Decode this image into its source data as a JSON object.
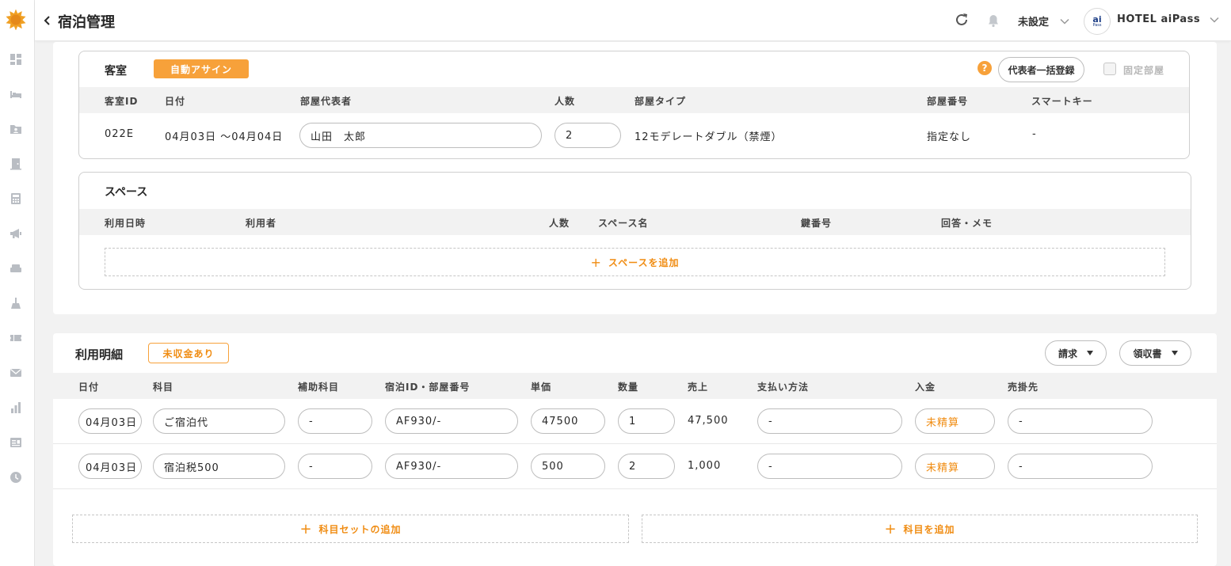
{
  "header": {
    "title": "宿泊管理",
    "status_select": "未設定",
    "hotel_name": "HOTEL aiPass",
    "avatar_text": "ai",
    "avatar_sub": "Pass"
  },
  "sidebar": {
    "icons": [
      "dashboard-icon",
      "bed-icon",
      "guest-folder-icon",
      "door-icon",
      "calculator-icon",
      "megaphone-icon",
      "sofa-icon",
      "cleaning-icon",
      "ticket-icon",
      "mail-icon",
      "bar-chart-icon",
      "id-card-icon",
      "clock-icon"
    ]
  },
  "room": {
    "label": "客室",
    "auto_assign": "自動アサイン",
    "help": "?",
    "bulk_register": "代表者一括登録",
    "fixed_room": "固定部屋",
    "columns": [
      "客室ID",
      "日付",
      "部屋代表者",
      "人数",
      "部屋タイプ",
      "部屋番号",
      "スマートキー"
    ],
    "row": {
      "id": "022E",
      "date": "04月03日 〜04月04日",
      "representative": "山田　太郎",
      "people": "2",
      "room_type": "12モデレートダブル（禁煙）",
      "room_number": "指定なし",
      "smart_key": "-"
    }
  },
  "space": {
    "label": "スペース",
    "columns": [
      "利用日時",
      "利用者",
      "人数",
      "スペース名",
      "鍵番号",
      "回答・メモ"
    ],
    "add_label": "スペースを追加"
  },
  "usage": {
    "label": "利用明細",
    "unpaid_badge": "未収金あり",
    "invoice_button": "請求",
    "receipt_button": "領収書",
    "columns": [
      "日付",
      "科目",
      "補助科目",
      "宿泊ID・部屋番号",
      "単価",
      "数量",
      "売上",
      "支払い方法",
      "入金",
      "売掛先"
    ],
    "rows": [
      {
        "date": "04月03日",
        "subject": "ご宿泊代",
        "sub_subject": "-",
        "stay_id": "AF930/-",
        "unit_price": "47500",
        "quantity": "1",
        "sales": "47,500",
        "payment_method": "-",
        "deposit": "未精算",
        "receivable": "-"
      },
      {
        "date": "04月03日",
        "subject": "宿泊税500",
        "sub_subject": "-",
        "stay_id": "AF930/-",
        "unit_price": "500",
        "quantity": "2",
        "sales": "1,000",
        "payment_method": "-",
        "deposit": "未精算",
        "receivable": "-"
      }
    ],
    "add_set_label": "科目セットの追加",
    "add_item_label": "科目を追加"
  },
  "colors": {
    "accent": "#f7a13a",
    "accent_text": "#f08c12",
    "icon_gray": "#b9bdc3"
  }
}
